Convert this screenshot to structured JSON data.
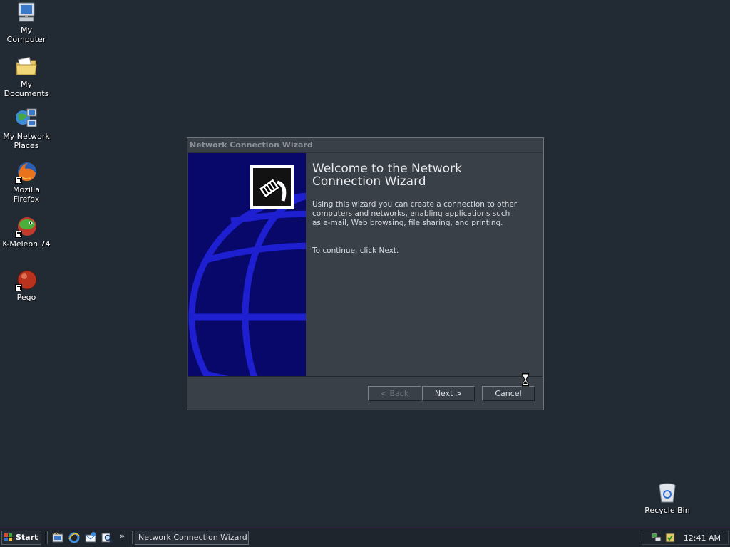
{
  "desktop": {
    "icons": [
      {
        "label": "My Computer"
      },
      {
        "label": "My Documents"
      },
      {
        "label": "My Network Places"
      },
      {
        "label": "Mozilla Firefox"
      },
      {
        "label": "K-Meleon 74"
      },
      {
        "label": "Pego"
      }
    ],
    "recycle_bin": {
      "label": "Recycle Bin"
    }
  },
  "wizard": {
    "title": "Network Connection Wizard",
    "heading": "Welcome to the Network Connection Wizard",
    "description": "Using this wizard you can create a connection to other computers and networks, enabling applications such as e-mail, Web browsing, file sharing, and printing.",
    "continue_text": "To continue, click Next.",
    "buttons": {
      "back": "< Back",
      "next": "Next >",
      "cancel": "Cancel"
    },
    "back_enabled": false,
    "sidepanel_color": "#07086a"
  },
  "taskbar": {
    "start_label": "Start",
    "quick_launch": [
      "show-desktop-icon",
      "internet-explorer-icon",
      "outlook-express-icon",
      "search-icon"
    ],
    "more_glyph": "»",
    "tasks": [
      {
        "label": "Network Connection Wizard"
      }
    ],
    "clock": "12:41 AM"
  }
}
